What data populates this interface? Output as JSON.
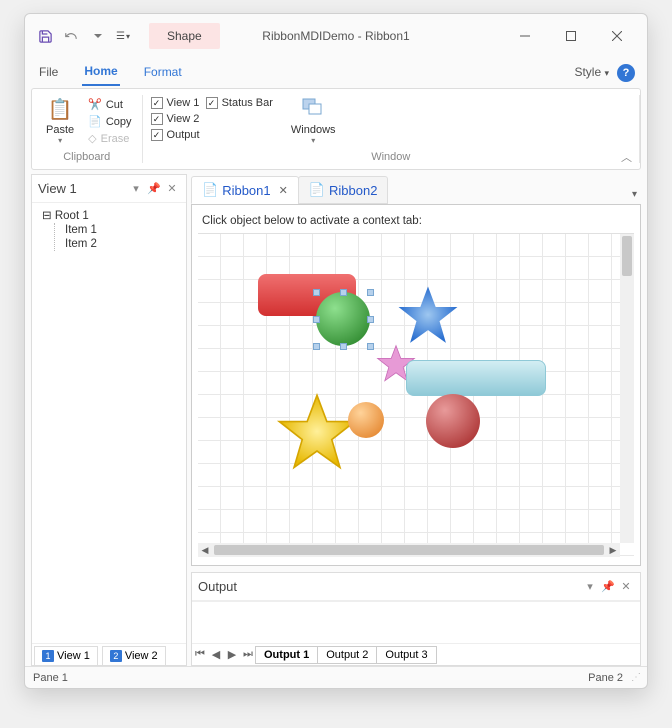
{
  "titlebar": {
    "title": "RibbonMDIDemo - Ribbon1",
    "shape_tab": "Shape"
  },
  "menubar": {
    "file": "File",
    "home": "Home",
    "format": "Format",
    "style": "Style"
  },
  "ribbon": {
    "paste": "Paste",
    "cut": "Cut",
    "copy": "Copy",
    "erase": "Erase",
    "clipboard_label": "Clipboard",
    "view1": "View 1",
    "view2": "View 2",
    "output": "Output",
    "statusbar": "Status Bar",
    "windows": "Windows",
    "window_label": "Window"
  },
  "view_pane": {
    "title": "View 1",
    "tree": {
      "root": "Root 1",
      "items": [
        "Item 1",
        "Item 2"
      ]
    },
    "tabs": [
      "View 1",
      "View 2"
    ]
  },
  "doc_tabs": [
    "Ribbon1",
    "Ribbon2"
  ],
  "canvas_hint": "Click object below to activate a context tab:",
  "output_pane": {
    "title": "Output",
    "tabs": [
      "Output 1",
      "Output 2",
      "Output 3"
    ]
  },
  "statusbar": {
    "left": "Pane 1",
    "right": "Pane 2"
  }
}
